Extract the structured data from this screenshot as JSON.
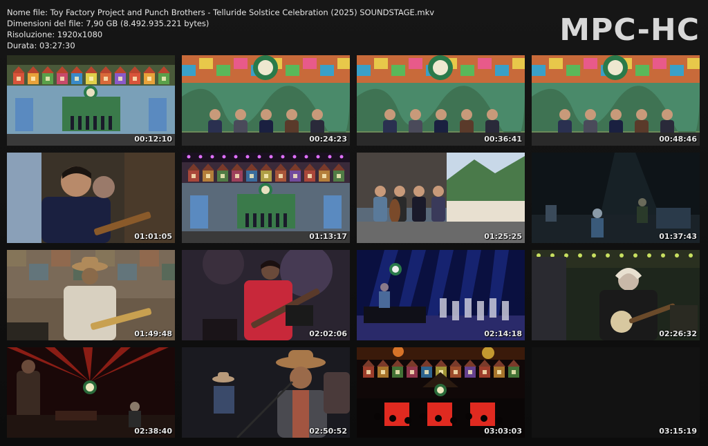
{
  "info": {
    "filename": "Nome file: Toy Factory Project and Punch Brothers - Telluride Solstice Celebration (2025) SOUNDSTAGE.mkv",
    "filesize": "Dimensioni del file: 7,90 GB (8.492.935.221 bytes)",
    "resolution": "Risoluzione: 1920x1080",
    "duration": "Durata: 03:27:30"
  },
  "logo": "MPC-HC",
  "thumbnails": [
    {
      "time": "00:12:10",
      "scene": "wide-stage-day"
    },
    {
      "time": "00:24:23",
      "scene": "band-closeup-day"
    },
    {
      "time": "00:36:41",
      "scene": "band-closeup-day"
    },
    {
      "time": "00:48:46",
      "scene": "band-closeup-day"
    },
    {
      "time": "01:01:05",
      "scene": "guitarist-closeup"
    },
    {
      "time": "01:13:17",
      "scene": "wide-stage-dusk"
    },
    {
      "time": "01:25:25",
      "scene": "stage-mountains"
    },
    {
      "time": "01:37:43",
      "scene": "dark-stage"
    },
    {
      "time": "01:49:48",
      "scene": "cowboy-singer"
    },
    {
      "time": "02:02:06",
      "scene": "bassist-red"
    },
    {
      "time": "02:14:18",
      "scene": "blue-stage"
    },
    {
      "time": "02:26:32",
      "scene": "banjo-player"
    },
    {
      "time": "02:38:40",
      "scene": "red-lights"
    },
    {
      "time": "02:50:52",
      "scene": "cowboy-mic"
    },
    {
      "time": "03:03:03",
      "scene": "night-stage-red"
    },
    {
      "time": "03:15:19",
      "scene": "empty"
    }
  ]
}
